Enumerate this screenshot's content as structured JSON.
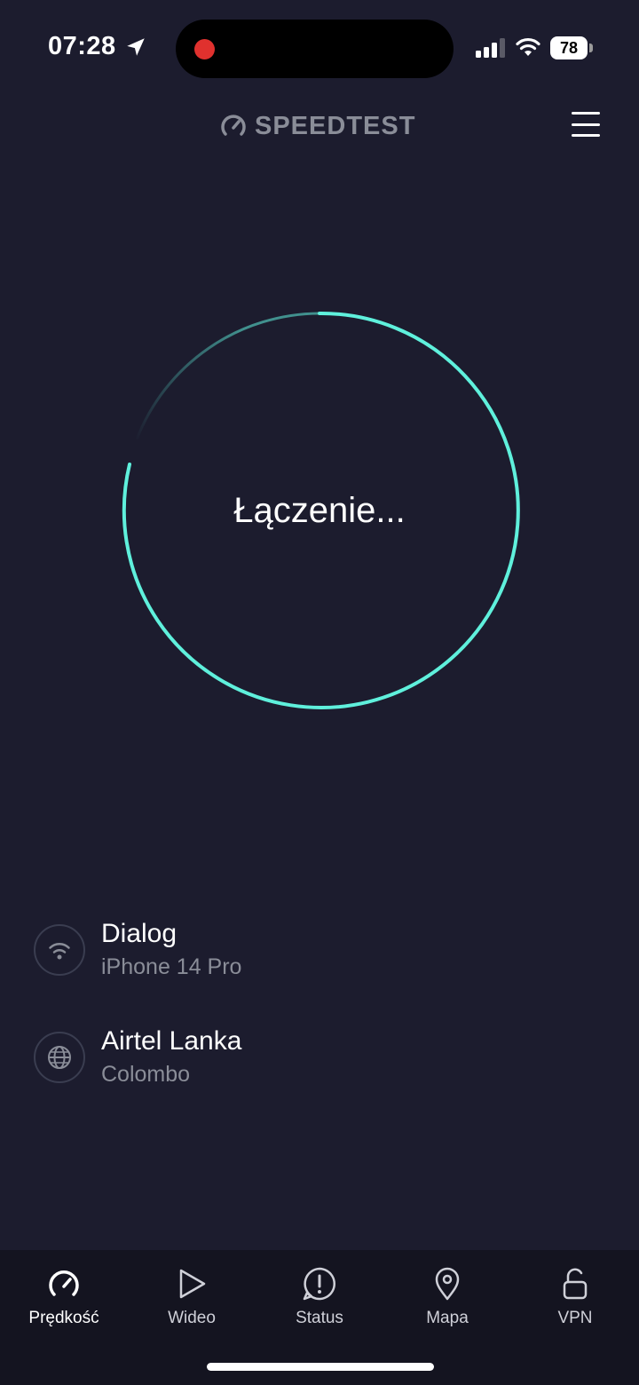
{
  "status_bar": {
    "time": "07:28",
    "battery": "78",
    "icons": [
      "location-arrow-icon",
      "recording-dot-icon",
      "cellular-signal-icon",
      "wifi-icon",
      "battery-icon"
    ],
    "recording_color": "#e0312e"
  },
  "header": {
    "logo_text": "SPEEDTEST",
    "logo_icon": "speedometer-icon",
    "menu_icon": "hamburger-menu-icon"
  },
  "test": {
    "status_text": "Łączenie...",
    "ring_color": "#5ff0dc"
  },
  "connection": {
    "provider": "Dialog",
    "device": "iPhone 14 Pro",
    "provider_icon": "wifi-icon"
  },
  "server": {
    "name": "Airtel Lanka",
    "location": "Colombo",
    "server_icon": "globe-icon"
  },
  "tabs": [
    {
      "label": "Prędkość",
      "icon": "speedometer-icon",
      "active": true
    },
    {
      "label": "Wideo",
      "icon": "play-icon",
      "active": false
    },
    {
      "label": "Status",
      "icon": "alert-icon",
      "active": false
    },
    {
      "label": "Mapa",
      "icon": "map-pin-icon",
      "active": false
    },
    {
      "label": "VPN",
      "icon": "unlock-icon",
      "active": false
    }
  ],
  "colors": {
    "background": "#1c1c2e",
    "tabbar": "#141420",
    "accent": "#5ff0dc",
    "muted_text": "#8a8d98"
  }
}
